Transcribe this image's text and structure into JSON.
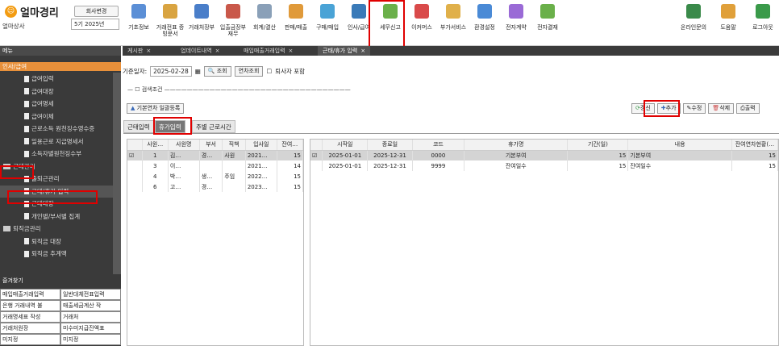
{
  "app": {
    "logo": "얼마경리",
    "company": "얼마상사",
    "change_company": "회사변경",
    "period": "5기 2025년"
  },
  "menu": [
    {
      "label": "기초정보",
      "icon": "basic-info-icon",
      "color": "#5b8fd6"
    },
    {
      "label": "거래전표 증빙문서",
      "icon": "voucher-icon",
      "color": "#d9a441"
    },
    {
      "label": "거래처장부",
      "icon": "ledger-icon",
      "color": "#4a7ec9"
    },
    {
      "label": "입출금장부 재무",
      "icon": "cash-icon",
      "color": "#c9584a"
    },
    {
      "label": "회계/결산",
      "icon": "accounting-icon",
      "color": "#8aa0b8"
    },
    {
      "label": "판매/매출",
      "icon": "sales-icon",
      "color": "#e09a3a"
    },
    {
      "label": "구매/매입",
      "icon": "purchase-icon",
      "color": "#4aa3d6"
    },
    {
      "label": "인사/급여",
      "icon": "hr-icon",
      "color": "#3a7ab8"
    },
    {
      "label": "세무신고",
      "icon": "tax-icon",
      "color": "#6bb04a"
    },
    {
      "label": "이커머스",
      "icon": "ecommerce-icon",
      "color": "#d94a4a"
    },
    {
      "label": "부가서비스",
      "icon": "addon-icon",
      "color": "#e0b04a"
    },
    {
      "label": "환경설정",
      "icon": "settings-icon",
      "color": "#4a8ad6"
    },
    {
      "label": "전자계약",
      "icon": "contract-icon",
      "color": "#9a6ad6"
    },
    {
      "label": "전자결재",
      "icon": "approval-icon",
      "color": "#6ab04a"
    }
  ],
  "right_menu": [
    {
      "label": "온라인문의",
      "icon": "support-icon",
      "color": "#3a8a4a"
    },
    {
      "label": "도움말",
      "icon": "help-icon",
      "color": "#e0a03a"
    },
    {
      "label": "로그아웃",
      "icon": "logout-icon",
      "color": "#3a9a4a"
    }
  ],
  "sidebar": {
    "header": "메뉴",
    "section": "인사/급여",
    "quick_title": "즐겨찾기",
    "items": [
      {
        "label": "급여입력",
        "type": "doc",
        "indent": 30
      },
      {
        "label": "급여대장",
        "type": "doc",
        "indent": 30
      },
      {
        "label": "급여명세",
        "type": "doc",
        "indent": 30
      },
      {
        "label": "급여이체",
        "type": "doc",
        "indent": 30
      },
      {
        "label": "근로소득 원천징수영수증",
        "type": "doc",
        "indent": 30
      },
      {
        "label": "일용근로 지급명세서",
        "type": "doc",
        "indent": 30
      },
      {
        "label": "소득자별원천징수부",
        "type": "doc",
        "indent": 30
      },
      {
        "label": "근태관리",
        "type": "folder",
        "indent": 4
      },
      {
        "label": "출퇴근관리",
        "type": "doc",
        "indent": 30
      },
      {
        "label": "근태/휴가 입력",
        "type": "doc",
        "indent": 30,
        "selected": true
      },
      {
        "label": "근태대장",
        "type": "doc",
        "indent": 30
      },
      {
        "label": "개인별/부서별 집계",
        "type": "doc",
        "indent": 30
      },
      {
        "label": "퇴직금관리",
        "type": "folder",
        "indent": 4
      },
      {
        "label": "퇴직금 대장",
        "type": "doc",
        "indent": 30
      },
      {
        "label": "퇴직금 추계액",
        "type": "doc",
        "indent": 30
      }
    ],
    "quick": [
      [
        "매입매출거래입력",
        "일반대체전표입력"
      ],
      [
        "은행 거래내역 불",
        "매출세금계산 작"
      ],
      [
        "거래명세표 작성",
        "거래처"
      ],
      [
        "거래처원장",
        "미수미지급잔액표"
      ],
      [
        "미지정",
        "미지정"
      ]
    ]
  },
  "tabs": [
    {
      "label": "게시판"
    },
    {
      "label": "업데이트내역"
    },
    {
      "label": "매입매출거래입력"
    },
    {
      "label": "근태/휴가 입력",
      "active": true
    }
  ],
  "search": {
    "label": "기준일자:",
    "date": "2025-02-28",
    "search_btn": "조회",
    "annual_btn": "연차조회",
    "retired": "퇴사자 포함",
    "cond": "검색조건"
  },
  "action": {
    "bulk": "기본연차 일괄등록",
    "refresh": "갱신",
    "add": "추가",
    "edit": "수정",
    "delete": "삭제",
    "print": "출력"
  },
  "subtabs": [
    {
      "label": "근태입력"
    },
    {
      "label": "휴가입력",
      "active": true
    },
    {
      "label": "주별 근로시간"
    }
  ],
  "grid1": {
    "headers": [
      "사원…",
      "사원명",
      "부서",
      "직책",
      "입사일",
      "잔여…"
    ],
    "rows": [
      [
        "1",
        "김…",
        "경…",
        "사원",
        "2021…",
        "15"
      ],
      [
        "3",
        "이…",
        "",
        "",
        "2021…",
        "14"
      ],
      [
        "4",
        "박…",
        "생…",
        "주임",
        "2022…",
        "15"
      ],
      [
        "6",
        "고…",
        "경…",
        "",
        "2023…",
        "15"
      ]
    ]
  },
  "grid2": {
    "headers": [
      "시작일",
      "종료일",
      "코드",
      "휴가명",
      "기간(일)",
      "내용",
      "잔여연차현황(…"
    ],
    "rows": [
      [
        "2025-01-01",
        "2025-12-31",
        "0000",
        "기본부여",
        "15",
        "기본부여",
        "15"
      ],
      [
        "2025-01-01",
        "2025-12-31",
        "9999",
        "잔여일수",
        "15",
        "잔여일수",
        "15"
      ]
    ]
  }
}
